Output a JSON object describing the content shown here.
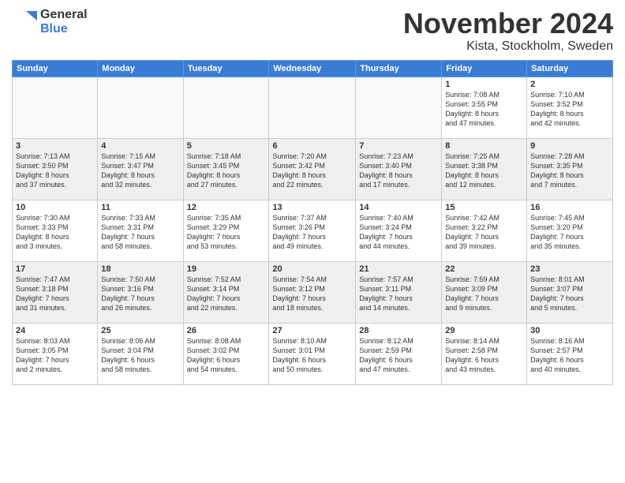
{
  "logo": {
    "general": "General",
    "blue": "Blue"
  },
  "title": {
    "month": "November 2024",
    "location": "Kista, Stockholm, Sweden"
  },
  "headers": [
    "Sunday",
    "Monday",
    "Tuesday",
    "Wednesday",
    "Thursday",
    "Friday",
    "Saturday"
  ],
  "weeks": [
    [
      {
        "day": "",
        "info": ""
      },
      {
        "day": "",
        "info": ""
      },
      {
        "day": "",
        "info": ""
      },
      {
        "day": "",
        "info": ""
      },
      {
        "day": "",
        "info": ""
      },
      {
        "day": "1",
        "info": "Sunrise: 7:08 AM\nSunset: 3:55 PM\nDaylight: 8 hours\nand 47 minutes."
      },
      {
        "day": "2",
        "info": "Sunrise: 7:10 AM\nSunset: 3:52 PM\nDaylight: 8 hours\nand 42 minutes."
      }
    ],
    [
      {
        "day": "3",
        "info": "Sunrise: 7:13 AM\nSunset: 3:50 PM\nDaylight: 8 hours\nand 37 minutes."
      },
      {
        "day": "4",
        "info": "Sunrise: 7:15 AM\nSunset: 3:47 PM\nDaylight: 8 hours\nand 32 minutes."
      },
      {
        "day": "5",
        "info": "Sunrise: 7:18 AM\nSunset: 3:45 PM\nDaylight: 8 hours\nand 27 minutes."
      },
      {
        "day": "6",
        "info": "Sunrise: 7:20 AM\nSunset: 3:42 PM\nDaylight: 8 hours\nand 22 minutes."
      },
      {
        "day": "7",
        "info": "Sunrise: 7:23 AM\nSunset: 3:40 PM\nDaylight: 8 hours\nand 17 minutes."
      },
      {
        "day": "8",
        "info": "Sunrise: 7:25 AM\nSunset: 3:38 PM\nDaylight: 8 hours\nand 12 minutes."
      },
      {
        "day": "9",
        "info": "Sunrise: 7:28 AM\nSunset: 3:35 PM\nDaylight: 8 hours\nand 7 minutes."
      }
    ],
    [
      {
        "day": "10",
        "info": "Sunrise: 7:30 AM\nSunset: 3:33 PM\nDaylight: 8 hours\nand 3 minutes."
      },
      {
        "day": "11",
        "info": "Sunrise: 7:33 AM\nSunset: 3:31 PM\nDaylight: 7 hours\nand 58 minutes."
      },
      {
        "day": "12",
        "info": "Sunrise: 7:35 AM\nSunset: 3:29 PM\nDaylight: 7 hours\nand 53 minutes."
      },
      {
        "day": "13",
        "info": "Sunrise: 7:37 AM\nSunset: 3:26 PM\nDaylight: 7 hours\nand 49 minutes."
      },
      {
        "day": "14",
        "info": "Sunrise: 7:40 AM\nSunset: 3:24 PM\nDaylight: 7 hours\nand 44 minutes."
      },
      {
        "day": "15",
        "info": "Sunrise: 7:42 AM\nSunset: 3:22 PM\nDaylight: 7 hours\nand 39 minutes."
      },
      {
        "day": "16",
        "info": "Sunrise: 7:45 AM\nSunset: 3:20 PM\nDaylight: 7 hours\nand 35 minutes."
      }
    ],
    [
      {
        "day": "17",
        "info": "Sunrise: 7:47 AM\nSunset: 3:18 PM\nDaylight: 7 hours\nand 31 minutes."
      },
      {
        "day": "18",
        "info": "Sunrise: 7:50 AM\nSunset: 3:16 PM\nDaylight: 7 hours\nand 26 minutes."
      },
      {
        "day": "19",
        "info": "Sunrise: 7:52 AM\nSunset: 3:14 PM\nDaylight: 7 hours\nand 22 minutes."
      },
      {
        "day": "20",
        "info": "Sunrise: 7:54 AM\nSunset: 3:12 PM\nDaylight: 7 hours\nand 18 minutes."
      },
      {
        "day": "21",
        "info": "Sunrise: 7:57 AM\nSunset: 3:11 PM\nDaylight: 7 hours\nand 14 minutes."
      },
      {
        "day": "22",
        "info": "Sunrise: 7:59 AM\nSunset: 3:09 PM\nDaylight: 7 hours\nand 9 minutes."
      },
      {
        "day": "23",
        "info": "Sunrise: 8:01 AM\nSunset: 3:07 PM\nDaylight: 7 hours\nand 5 minutes."
      }
    ],
    [
      {
        "day": "24",
        "info": "Sunrise: 8:03 AM\nSunset: 3:05 PM\nDaylight: 7 hours\nand 2 minutes."
      },
      {
        "day": "25",
        "info": "Sunrise: 8:06 AM\nSunset: 3:04 PM\nDaylight: 6 hours\nand 58 minutes."
      },
      {
        "day": "26",
        "info": "Sunrise: 8:08 AM\nSunset: 3:02 PM\nDaylight: 6 hours\nand 54 minutes."
      },
      {
        "day": "27",
        "info": "Sunrise: 8:10 AM\nSunset: 3:01 PM\nDaylight: 6 hours\nand 50 minutes."
      },
      {
        "day": "28",
        "info": "Sunrise: 8:12 AM\nSunset: 2:59 PM\nDaylight: 6 hours\nand 47 minutes."
      },
      {
        "day": "29",
        "info": "Sunrise: 8:14 AM\nSunset: 2:58 PM\nDaylight: 6 hours\nand 43 minutes."
      },
      {
        "day": "30",
        "info": "Sunrise: 8:16 AM\nSunset: 2:57 PM\nDaylight: 6 hours\nand 40 minutes."
      }
    ]
  ]
}
